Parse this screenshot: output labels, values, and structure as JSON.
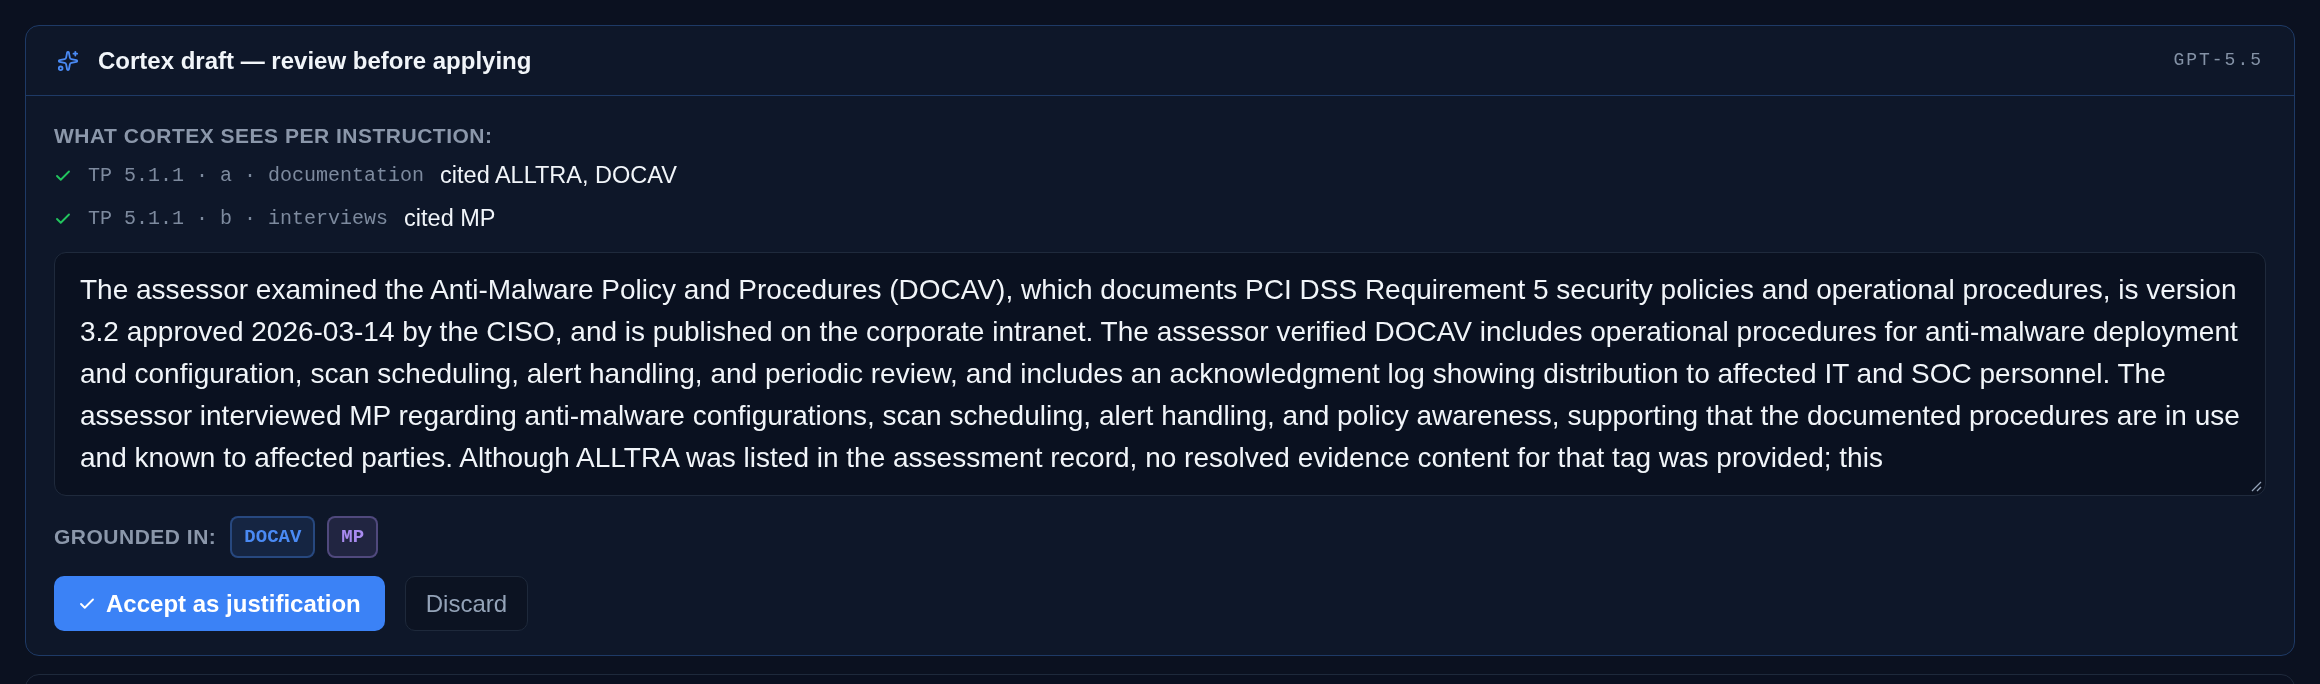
{
  "panel": {
    "title": "Cortex draft — review before applying",
    "model": "GPT-5.5"
  },
  "instructions": {
    "heading": "WHAT CORTEX SEES PER INSTRUCTION:",
    "items": [
      {
        "checked": true,
        "reference": "TP 5.1.1 · a · documentation",
        "citation": "cited ALLTRA, DOCAV"
      },
      {
        "checked": true,
        "reference": "TP 5.1.1 · b · interviews",
        "citation": "cited MP"
      }
    ]
  },
  "draft": {
    "value": "The assessor examined the Anti-Malware Policy and Procedures (DOCAV), which documents PCI DSS Requirement 5 security policies and operational procedures, is version 3.2 approved 2026-03-14 by the CISO, and is published on the corporate intranet. The assessor verified DOCAV includes operational procedures for anti-malware deployment and configuration, scan scheduling, alert handling, and periodic review, and includes an acknowledgment log showing distribution to affected IT and SOC personnel. The assessor interviewed MP regarding anti-malware configurations, scan scheduling, alert handling, and policy awareness, supporting that the documented procedures are in use and known to affected parties. Although ALLTRA was listed in the assessment record, no resolved evidence content for that tag was provided; this"
  },
  "grounded_in": {
    "label": "GROUNDED IN:",
    "tags": [
      {
        "text": "DOCAV",
        "color": "#4a8af4"
      },
      {
        "text": "MP",
        "color": "#a98bf0"
      }
    ]
  },
  "buttons": [
    {
      "kind": "primary",
      "label": "Accept as justification"
    },
    {
      "kind": "secondary",
      "label": "Discard"
    }
  ]
}
